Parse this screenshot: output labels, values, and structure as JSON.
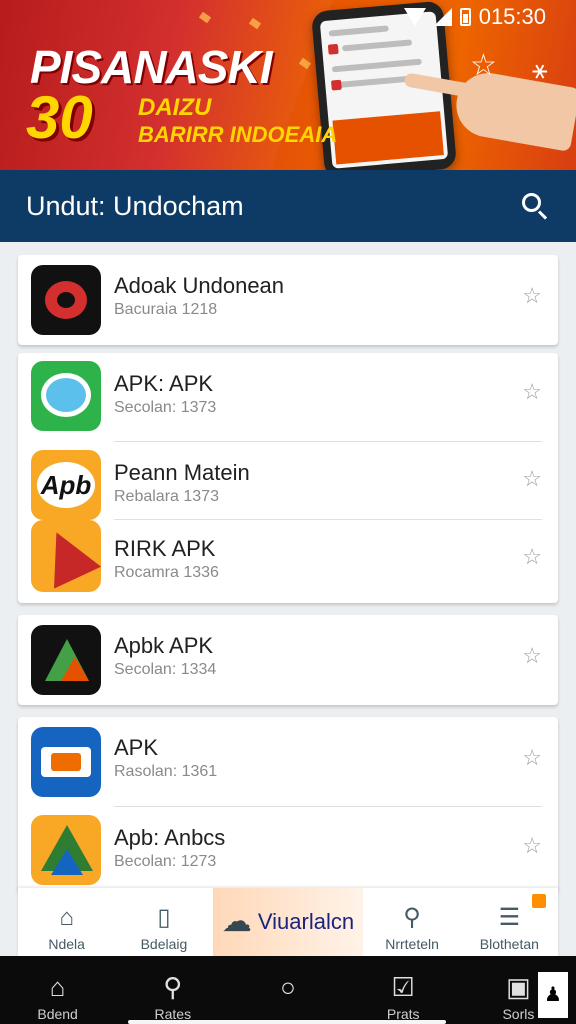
{
  "status_bar": {
    "time": "015:30"
  },
  "banner": {
    "title": "PISANASKI",
    "number": "30",
    "subtitle_1": "DAIZU",
    "subtitle_2": "BARIRR INDOEAIA"
  },
  "header": {
    "title": "Undut: Undocham",
    "search_icon": "search-icon"
  },
  "cards": [
    {
      "items": [
        {
          "name": "Adoak Undonean",
          "sub": "Bacuraia 1218",
          "icon": "red-swoosh-app-icon"
        }
      ]
    },
    {
      "items": [
        {
          "name": "APK: APK",
          "sub": "Secolan: 1373",
          "icon": "chat-bubble-app-icon"
        },
        {
          "name": "Peann Matein",
          "sub": "Rebalara 1373",
          "icon": "apk-logo-app-icon"
        },
        {
          "name": "RIRK APK",
          "sub": "Rocamra 1336",
          "icon": "triangle-arrow-app-icon"
        }
      ]
    },
    {
      "items": [
        {
          "name": "Apbk APK",
          "sub": "Secolan: 1334",
          "icon": "play-triangle-app-icon"
        }
      ]
    },
    {
      "items": [
        {
          "name": "APK",
          "sub": "Rasolan: 1361",
          "icon": "blue-box-app-icon"
        },
        {
          "name": "Apb: Anbcs",
          "sub": "Becolan: 1273",
          "icon": "drive-triangle-app-icon"
        }
      ]
    }
  ],
  "bottom_nav": [
    {
      "label": "Ndela",
      "icon": "home-icon"
    },
    {
      "label": "Bdelaig",
      "icon": "bookmark-icon"
    },
    {
      "label": "Viuarlalcn",
      "icon": "cloud-icon",
      "active": true
    },
    {
      "label": "Nrrteteln",
      "icon": "search-icon"
    },
    {
      "label": "Blothetan",
      "icon": "document-icon"
    }
  ],
  "system_nav": [
    {
      "label": "Bdend",
      "icon": "home-outline-icon"
    },
    {
      "label": "Rates",
      "icon": "search-outline-icon"
    },
    {
      "label": "",
      "icon": "circle-icon"
    },
    {
      "label": "Prats",
      "icon": "check-box-icon"
    },
    {
      "label": "Sorls",
      "icon": "bag-icon"
    }
  ],
  "colors": {
    "header": "#0d3b66",
    "banner_red": "#d32f2f",
    "banner_orange": "#ef6c00",
    "accent": "#ffd600"
  }
}
